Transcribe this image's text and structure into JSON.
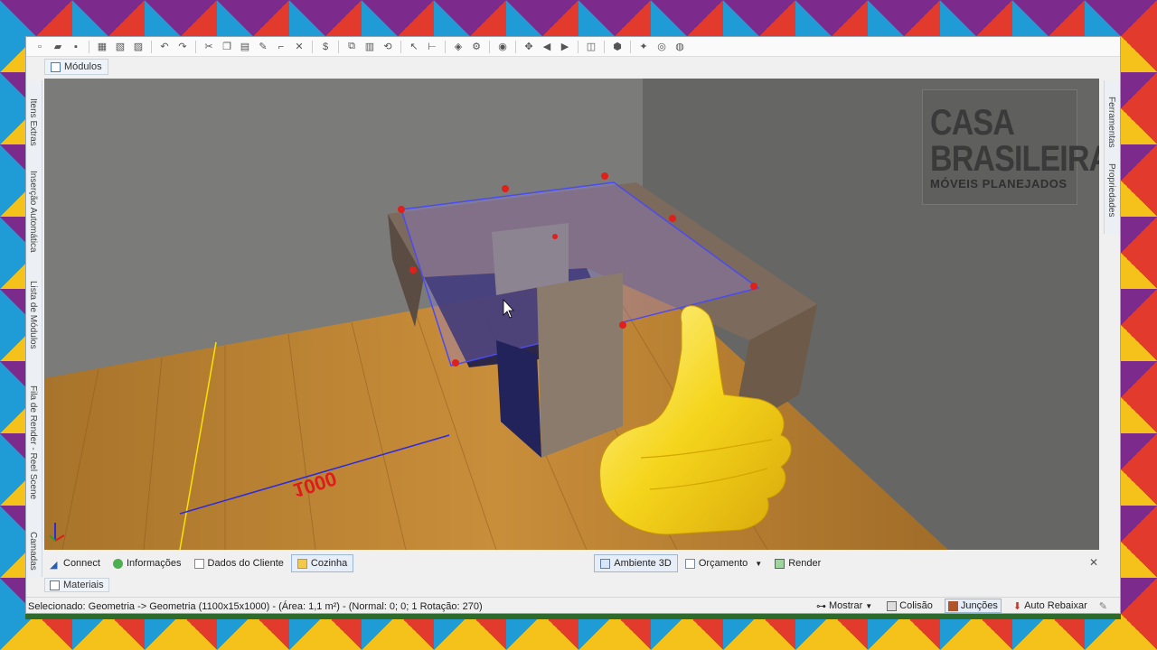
{
  "window": {
    "top_tab": "Módulos",
    "left_panels": [
      "Itens Extras",
      "Inserção Automática",
      "Lista de Módulos",
      "Fila de Render - Reel Scene",
      "Camadas"
    ],
    "right_panels": [
      "Ferramentas",
      "Propriedades"
    ]
  },
  "viewport": {
    "logo_line1": "CASA",
    "logo_line2": "BRASILEIRA",
    "logo_line3": "MÓVEIS PLANEJADOS",
    "dimension_label": "1000"
  },
  "bottom_tabs": {
    "connect": "Connect",
    "informacoes": "Informações",
    "dados_cliente": "Dados do Cliente",
    "cozinha": "Cozinha",
    "ambiente3d": "Ambiente 3D",
    "orcamento": "Orçamento",
    "render": "Render"
  },
  "materials_tab": "Materiais",
  "status": {
    "selection": "Selecionado: Geometria -> Geometria (1100x15x1000) - (Área: 1,1 m²) - (Normal: 0; 0; 1 Rotação: 270)",
    "mostrar": "Mostrar",
    "colisao": "Colisão",
    "juncoes": "Junções",
    "auto_rebaixar": "Auto Rebaixar"
  }
}
